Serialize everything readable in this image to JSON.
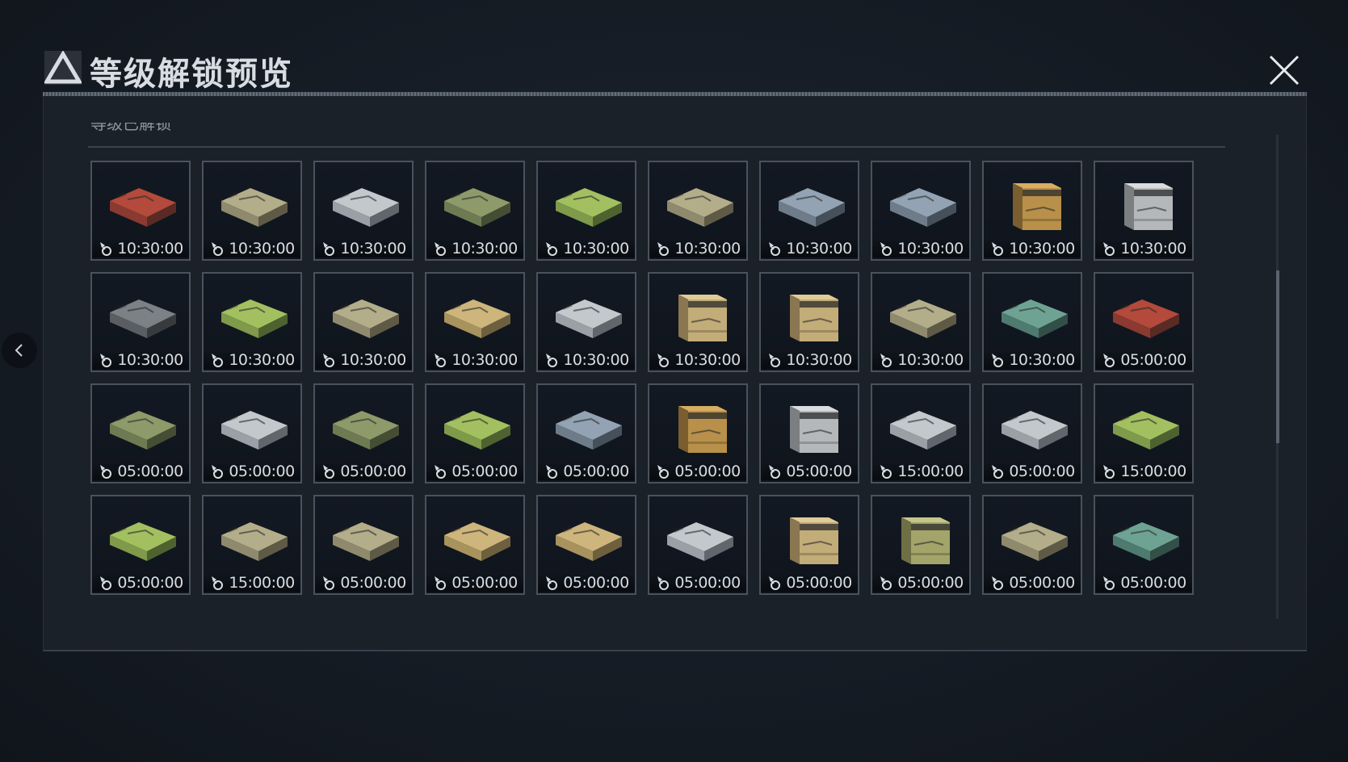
{
  "header": {
    "title": "等级解锁预览"
  },
  "section": {
    "label": "等级已解锁"
  },
  "icons": {
    "logo": "triangle-logo-icon",
    "close": "close-x-icon",
    "back": "chevron-left-icon",
    "timer": "boost-timer-icon"
  },
  "colors": {
    "tile_border": "#4a525c",
    "tile_bg": "#131923",
    "text": "#d9dde2"
  },
  "items": [
    {
      "style": "red",
      "timer": "10:30:00"
    },
    {
      "style": "khaki",
      "timer": "10:30:00"
    },
    {
      "style": "silver",
      "timer": "10:30:00"
    },
    {
      "style": "olive",
      "timer": "10:30:00"
    },
    {
      "style": "lime",
      "timer": "10:30:00"
    },
    {
      "style": "khaki",
      "timer": "10:30:00"
    },
    {
      "style": "blue",
      "timer": "10:30:00"
    },
    {
      "style": "blue",
      "timer": "10:30:00"
    },
    {
      "style": "crate-gold",
      "timer": "10:30:00"
    },
    {
      "style": "crate-white",
      "timer": "10:30:00"
    },
    {
      "style": "dark",
      "timer": "10:30:00"
    },
    {
      "style": "lime",
      "timer": "10:30:00"
    },
    {
      "style": "khaki",
      "timer": "10:30:00"
    },
    {
      "style": "tan",
      "timer": "10:30:00"
    },
    {
      "style": "silver",
      "timer": "10:30:00"
    },
    {
      "style": "crate-beige",
      "timer": "10:30:00"
    },
    {
      "style": "crate-beige",
      "timer": "10:30:00"
    },
    {
      "style": "khaki",
      "timer": "10:30:00"
    },
    {
      "style": "teal",
      "timer": "10:30:00"
    },
    {
      "style": "red",
      "timer": "05:00:00"
    },
    {
      "style": "olive",
      "timer": "05:00:00"
    },
    {
      "style": "silver",
      "timer": "05:00:00"
    },
    {
      "style": "olive",
      "timer": "05:00:00"
    },
    {
      "style": "lime",
      "timer": "05:00:00"
    },
    {
      "style": "blue",
      "timer": "05:00:00"
    },
    {
      "style": "crate-gold",
      "timer": "05:00:00"
    },
    {
      "style": "crate-white",
      "timer": "05:00:00"
    },
    {
      "style": "silver",
      "timer": "15:00:00"
    },
    {
      "style": "silver",
      "timer": "05:00:00"
    },
    {
      "style": "lime",
      "timer": "15:00:00"
    },
    {
      "style": "lime",
      "timer": "05:00:00"
    },
    {
      "style": "khaki",
      "timer": "15:00:00"
    },
    {
      "style": "khaki",
      "timer": "05:00:00"
    },
    {
      "style": "tan",
      "timer": "05:00:00"
    },
    {
      "style": "tan",
      "timer": "05:00:00"
    },
    {
      "style": "silver",
      "timer": "05:00:00"
    },
    {
      "style": "crate-beige",
      "timer": "05:00:00"
    },
    {
      "style": "crate-olive",
      "timer": "05:00:00"
    },
    {
      "style": "khaki",
      "timer": "05:00:00"
    },
    {
      "style": "teal",
      "timer": "05:00:00"
    }
  ]
}
